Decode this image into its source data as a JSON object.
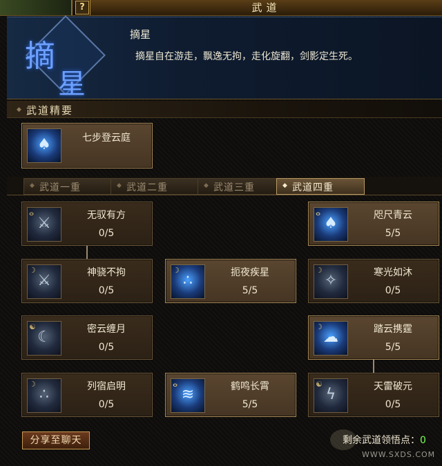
{
  "window": {
    "title": "武道",
    "help_label": "?"
  },
  "header": {
    "emblem_char1": "摘",
    "emblem_char2": "星",
    "skill_name": "摘星",
    "skill_desc": "摘星自在游走，飘逸无拘，走化旋翻，剑影定生死。"
  },
  "essentials": {
    "title": "武道精要",
    "card": {
      "name": "七步登云庭"
    }
  },
  "tabs": [
    {
      "label": "武道一重"
    },
    {
      "label": "武道二重"
    },
    {
      "label": "武道三重"
    },
    {
      "label": "武道四重",
      "active": true
    }
  ],
  "skills": [
    {
      "name": "无驭有方",
      "level": "0/5"
    },
    {
      "name": "咫尺青云",
      "level": "5/5"
    },
    {
      "name": "神骁不拘",
      "level": "0/5"
    },
    {
      "name": "扼夜疾星",
      "level": "5/5"
    },
    {
      "name": "寒光如沐",
      "level": "0/5"
    },
    {
      "name": "密云缠月",
      "level": "0/5"
    },
    {
      "name": "踏云携霆",
      "level": "5/5"
    },
    {
      "name": "列宿启明",
      "level": "0/5"
    },
    {
      "name": "鹤鸣长霄",
      "level": "5/5"
    },
    {
      "name": "天雷破元",
      "level": "0/5"
    }
  ],
  "footer": {
    "share_label": "分享至聊天",
    "remaining_label": "剩余武道领悟点：",
    "remaining_value": "0",
    "watermark": "WWW.SXDS.COM"
  },
  "colors": {
    "accent_gold": "#c9a24f",
    "points_green": "#7cff5a",
    "panel_blue": "#162a44"
  }
}
